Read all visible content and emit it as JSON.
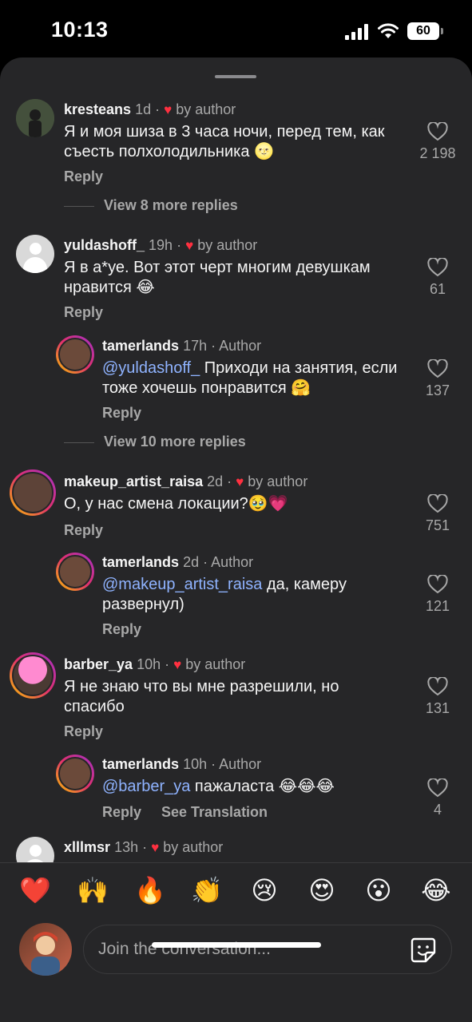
{
  "status": {
    "time": "10:13",
    "battery": "60"
  },
  "comments": [
    {
      "user": "kresteans",
      "time": "1d",
      "liked_by": "by author",
      "text": "Я и моя шиза в 3 часа ночи, перед тем, как съесть полхолодильника 🌝",
      "reply": "Reply",
      "likes": "2 198",
      "view_more": "View 8 more replies"
    },
    {
      "user": "yuldashoff_",
      "time": "19h",
      "liked_by": "by author",
      "text": "Я в а*уе. Вот этот черт многим девушкам нравится 😂",
      "reply": "Reply",
      "likes": "61",
      "sub": {
        "user": "tamerlands",
        "time": "17h",
        "tag": "Author",
        "mention": "@yuldashoff_",
        "text": " Приходи на занятия, если тоже хочешь понравится 🤗",
        "reply": "Reply",
        "likes": "137"
      },
      "view_more": "View 10 more replies"
    },
    {
      "user": "makeup_artist_raisa",
      "time": "2d",
      "liked_by": "by author",
      "text": "О, у нас смена локации?🥹💗",
      "reply": "Reply",
      "likes": "751",
      "sub": {
        "user": "tamerlands",
        "time": "2d",
        "tag": "Author",
        "mention": "@makeup_artist_raisa",
        "text": " да, камеру развернул)",
        "reply": "Reply",
        "likes": "121"
      }
    },
    {
      "user": "barber_ya",
      "time": "10h",
      "liked_by": "by author",
      "text": "Я не знаю что вы мне разрешили, но спасибо",
      "reply": "Reply",
      "likes": "131",
      "sub": {
        "user": "tamerlands",
        "time": "10h",
        "tag": "Author",
        "mention": "@barber_ya",
        "text": " пажаласта 😂😂😂",
        "reply": "Reply",
        "see_translation": "See Translation",
        "likes": "4"
      }
    },
    {
      "user": "xlllmsr",
      "time": "13h",
      "liked_by": "by author"
    }
  ],
  "reactions": [
    "❤️",
    "🙌",
    "🔥",
    "👏",
    "😢",
    "😍",
    "😮",
    "😂"
  ],
  "composer": {
    "placeholder": "Join the conversation..."
  },
  "colors": {
    "sheet": "#262628",
    "mention": "#8fb3ff",
    "heart": "#ff3040"
  }
}
